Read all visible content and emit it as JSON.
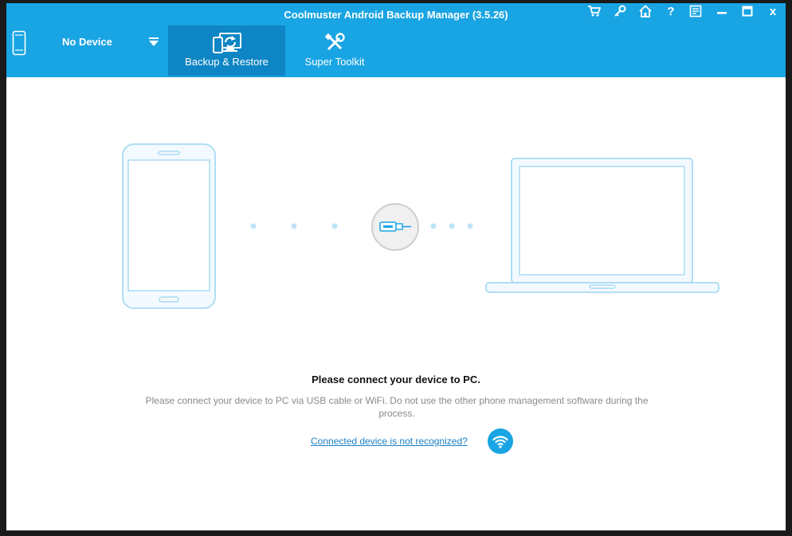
{
  "window": {
    "title": "Coolmuster Android Backup Manager (3.5.26)"
  },
  "device_selector": {
    "label": "No Device",
    "icon": "phone-icon",
    "dropdown_icon": "caret-down-icon"
  },
  "tabs": [
    {
      "label": "Backup & Restore",
      "icon": "backup-restore-icon",
      "active": true
    },
    {
      "label": "Super Toolkit",
      "icon": "tools-icon",
      "active": false
    }
  ],
  "toolbar_icons": [
    "cart-icon",
    "key-icon",
    "home-icon",
    "help-icon",
    "feedback-icon",
    "minimize-icon",
    "maximize-icon",
    "close-icon"
  ],
  "close_label": "x",
  "help_label": "?",
  "main": {
    "headline": "Please connect your device to PC.",
    "description": "Please connect your device to PC via USB cable or WiFi. Do not use the other phone management software during the process.",
    "help_link": "Connected device is not recognized?",
    "wifi_icon": "wifi-icon"
  },
  "colors": {
    "accent": "#19a4e3",
    "active_tab": "#0e85c4",
    "illustration": "#a9daf3"
  }
}
